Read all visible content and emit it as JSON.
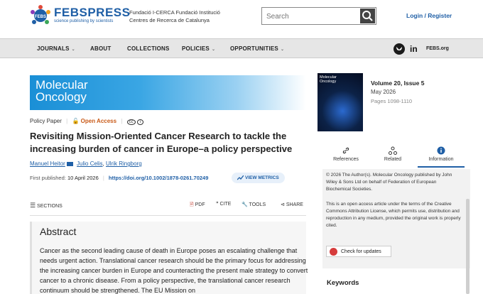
{
  "header": {
    "logo_febs": "FEBS",
    "logo_press": "PRESS",
    "logo_tagline": "science publishing by scientists",
    "org_line1": "Fundació I-CERCA Fundació Institució",
    "org_line2": "Centres de Recerca de Catalunya",
    "search_placeholder": "Search",
    "login_label": "Login / Register"
  },
  "nav": {
    "journals": "JOURNALS",
    "about": "ABOUT",
    "collections": "COLLECTIONS",
    "policies": "POLICIES",
    "opportunities": "OPPORTUNITIES",
    "febs_org": "FEBS.org"
  },
  "journal": {
    "banner_line1": "Molecular",
    "banner_line2": "Oncology",
    "cover_line1": "Molecular",
    "cover_line2": "Oncology",
    "volume": "Volume 20, Issue 5",
    "date": "May 2026",
    "pages": "Pages 1098-1110"
  },
  "article": {
    "type": "Policy Paper",
    "access": "Open Access",
    "title": "Revisiting Mission-Oriented Cancer Research to tackle the increasing burden of cancer in Europe–a policy perspective",
    "authors": [
      "Manuel Heitor",
      "Julio Celis",
      "Ulrik Ringborg"
    ],
    "first_published_label": "First published:",
    "first_published_date": "10 April 2026",
    "doi": "https://doi.org/10.1002/1878-0261.70249",
    "metrics_label": "VIEW METRICS"
  },
  "toolbar": {
    "sections": "SECTIONS",
    "pdf": "PDF",
    "cite": "CITE",
    "tools": "TOOLS",
    "share": "SHARE"
  },
  "abstract": {
    "heading": "Abstract",
    "text": "Cancer as the second leading cause of death in Europe poses an escalating challenge that needs urgent action. Translational cancer research should be the primary focus for addressing the increasing cancer burden in Europe and counteracting the present male strategy to convert cancer to a chronic disease. From a policy perspective, the translational cancer research continuum should be strengthened. The EU Mission on"
  },
  "sidebar": {
    "tab_references": "References",
    "tab_related": "Related",
    "tab_information": "Information",
    "copyright": "© 2026 The Author(s). Molecular Oncology published by John Wiley & Sons Ltd on behalf of Federation of European Biochemical Societies.",
    "license": "This is an open access article under the terms of the Creative Commons Attribution License, which permits use, distribution and reproduction in any medium, provided the original work is properly cited.",
    "check_updates": "Check for updates",
    "keywords": "Keywords"
  }
}
